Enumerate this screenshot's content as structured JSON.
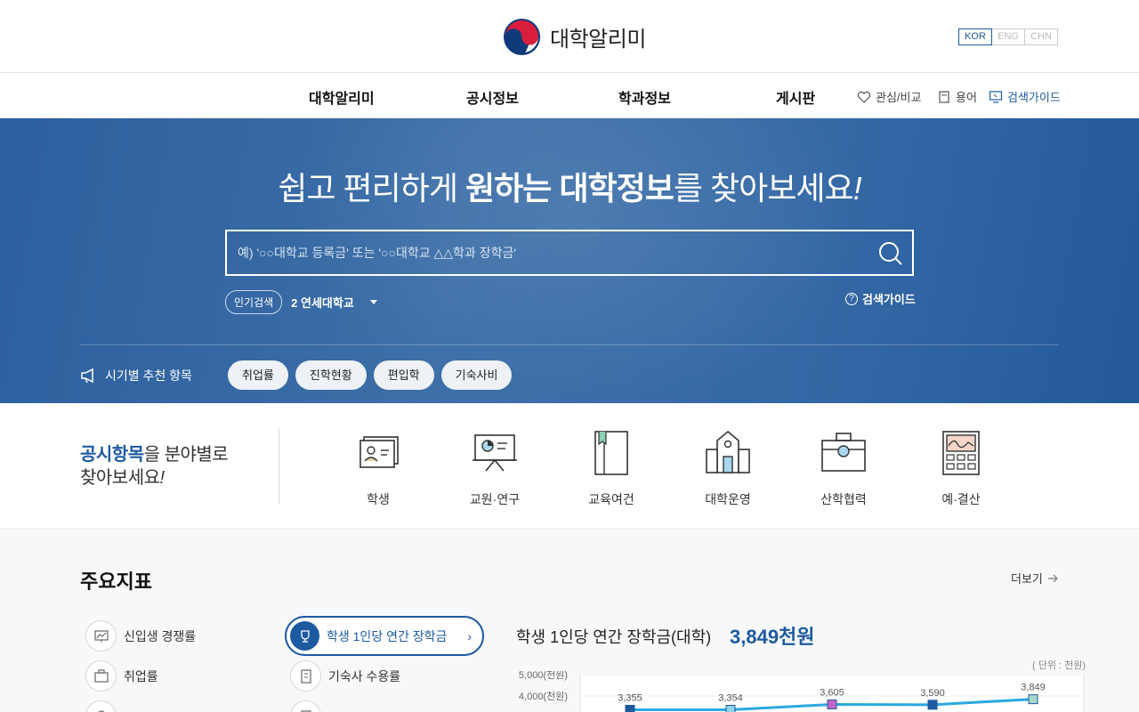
{
  "header": {
    "logo_text": "대학알리미",
    "languages": [
      "KOR",
      "ENG",
      "CHN"
    ],
    "active_language": "KOR"
  },
  "gnb": {
    "items": [
      "대학알리미",
      "공시정보",
      "학과정보",
      "게시판"
    ],
    "utils": [
      {
        "label": "관심/비교",
        "icon": "heart-icon"
      },
      {
        "label": "용어",
        "icon": "book-icon"
      },
      {
        "label": "검색가이드",
        "icon": "monitor-icon"
      }
    ]
  },
  "hero": {
    "title_pre": "쉽고 편리하게 ",
    "title_bold1": "원하는",
    "title_mid": " ",
    "title_bold2": "대학정보",
    "title_post": "를 찾아보세요",
    "title_end": "!",
    "search_placeholder": "예) '○○대학교 등록금' 또는 '○○대학교 △△학과 장학금'",
    "popular_label": "인기검색",
    "popular_value": "2 연세대학교",
    "guide_label": "검색가이드",
    "rec_label": "시기별 추천 항목",
    "chips": [
      "취업률",
      "진학현황",
      "편입학",
      "기숙사비"
    ]
  },
  "categories": {
    "title_hl": "공시항목",
    "title_rest1": "을 분야별로",
    "title_rest2": "찾아보세요",
    "title_end": "!",
    "items": [
      "학생",
      "교원·연구",
      "교육여건",
      "대학운영",
      "산학협력",
      "예·결산"
    ]
  },
  "indicators": {
    "title": "주요지표",
    "more": "더보기",
    "left": [
      "신입생 경쟁률",
      "취업률"
    ],
    "active": "학생 1인당 연간 장학금",
    "right": [
      "기숙사 수용률"
    ],
    "chart_title": "학생 1인당 연간 장학금(대학)",
    "chart_value": "3,849천원",
    "unit": "( 단위 : 천원)"
  },
  "chart_data": {
    "type": "line",
    "values": [
      3355,
      3354,
      3605,
      3590,
      3849
    ],
    "value_labels": [
      "3,355",
      "3,354",
      "3,605",
      "3,590",
      "3,849"
    ],
    "y_ticks": [
      "5,000(천원)",
      "4,000(천원)"
    ],
    "ylim": [
      0,
      5000
    ],
    "marker_colors": [
      "#1e5aa0",
      "#8fd3e8",
      "#c466c4",
      "#1e5aa0",
      "#a8d8c8"
    ],
    "line_color": "#29a8e0"
  }
}
